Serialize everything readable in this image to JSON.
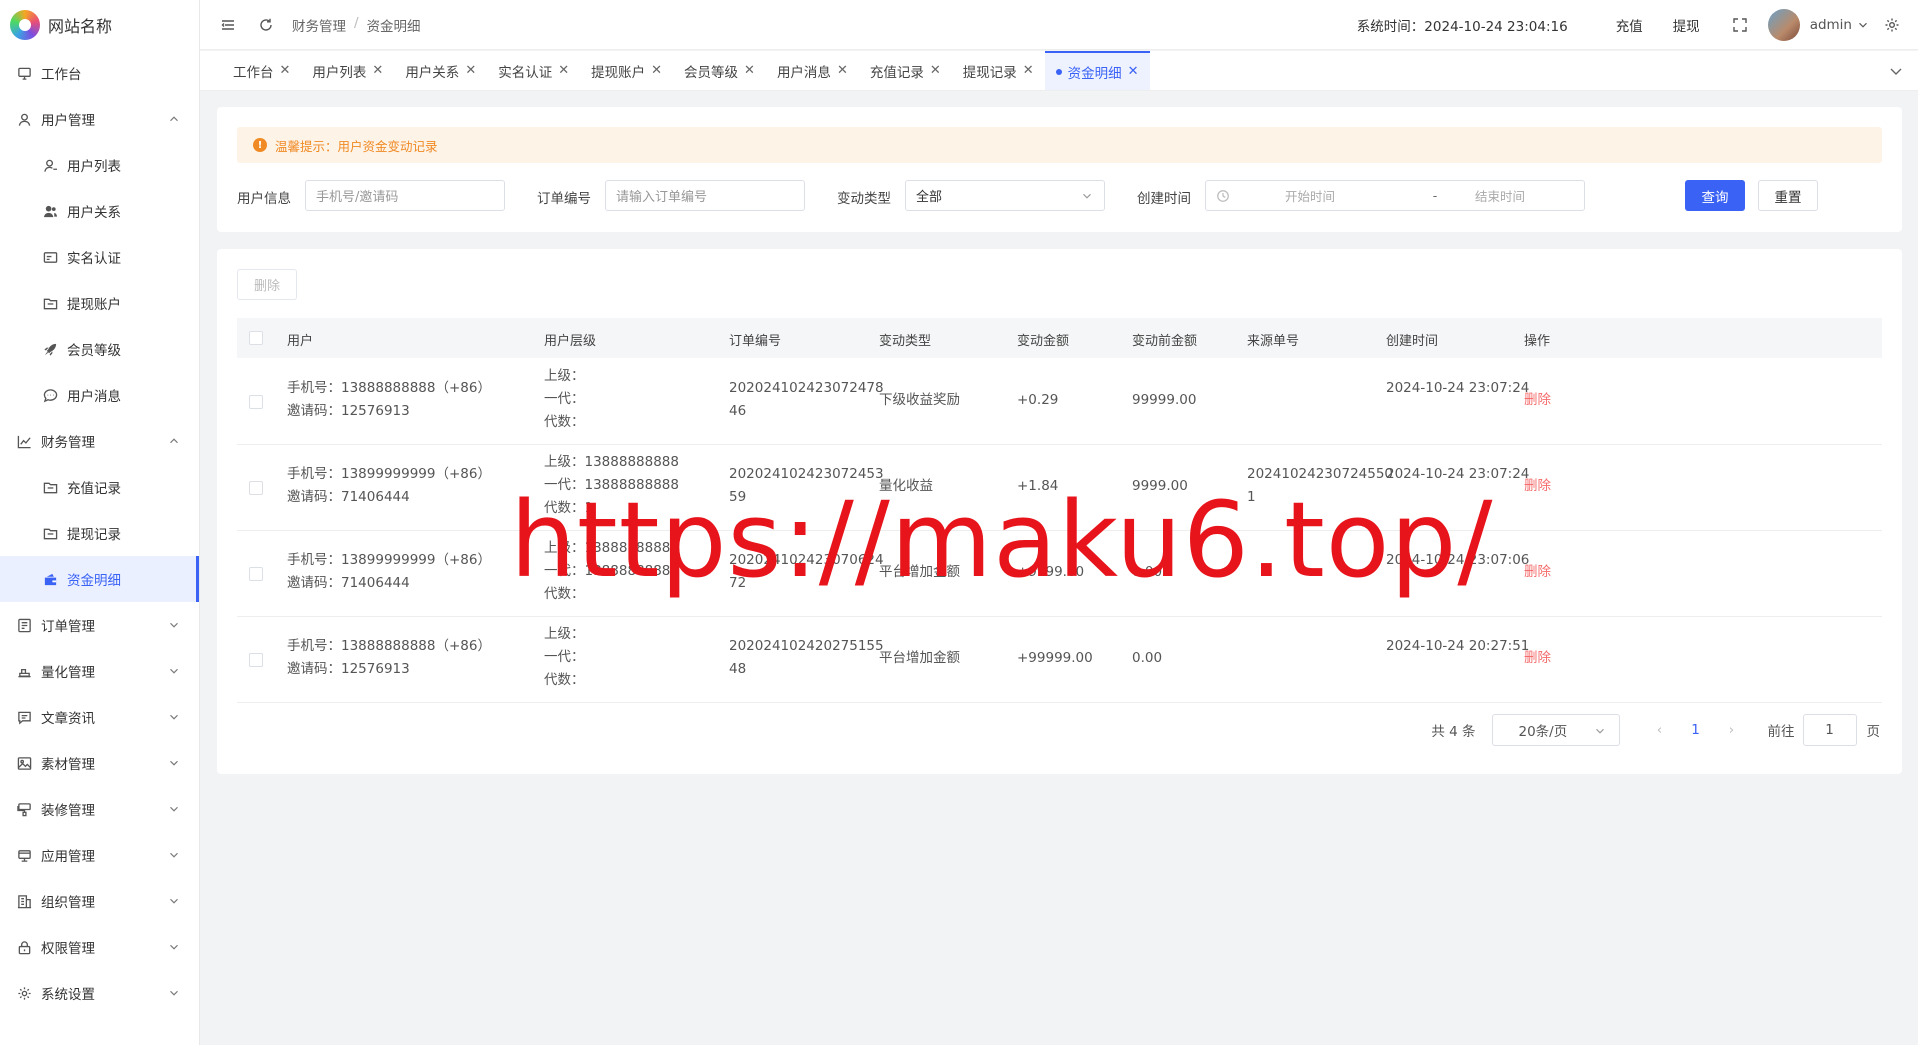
{
  "brand": {
    "name": "网站名称"
  },
  "sidebar": {
    "items": [
      {
        "label": "工作台",
        "icon": "monitor-icon"
      },
      {
        "label": "用户管理",
        "icon": "user-icon",
        "expanded": true
      },
      {
        "label": "用户列表",
        "icon": "user-outline-icon",
        "sub": true
      },
      {
        "label": "用户关系",
        "icon": "users-icon",
        "sub": true
      },
      {
        "label": "实名认证",
        "icon": "id-card-icon",
        "sub": true
      },
      {
        "label": "提现账户",
        "icon": "folder-icon",
        "sub": true
      },
      {
        "label": "会员等级",
        "icon": "rocket-icon",
        "sub": true
      },
      {
        "label": "用户消息",
        "icon": "chat-icon",
        "sub": true
      },
      {
        "label": "财务管理",
        "icon": "chart-icon",
        "expanded": true
      },
      {
        "label": "充值记录",
        "icon": "folder-icon",
        "sub": true
      },
      {
        "label": "提现记录",
        "icon": "folder-icon",
        "sub": true
      },
      {
        "label": "资金明细",
        "icon": "wallet-icon",
        "sub": true,
        "active": true
      },
      {
        "label": "订单管理",
        "icon": "list-icon"
      },
      {
        "label": "量化管理",
        "icon": "bar-icon"
      },
      {
        "label": "文章资讯",
        "icon": "message-icon"
      },
      {
        "label": "素材管理",
        "icon": "image-icon"
      },
      {
        "label": "装修管理",
        "icon": "brush-icon"
      },
      {
        "label": "应用管理",
        "icon": "app-icon"
      },
      {
        "label": "组织管理",
        "icon": "building-icon"
      },
      {
        "label": "权限管理",
        "icon": "lock-icon"
      },
      {
        "label": "系统设置",
        "icon": "gear-icon"
      }
    ]
  },
  "header": {
    "breadcrumb": [
      "财务管理",
      "资金明细"
    ],
    "system_time": "系统时间：2024-10-24 23:04:16",
    "recharge": "充值",
    "withdraw": "提现",
    "user": "admin"
  },
  "tabs": [
    {
      "label": "工作台"
    },
    {
      "label": "用户列表"
    },
    {
      "label": "用户关系"
    },
    {
      "label": "实名认证"
    },
    {
      "label": "提现账户"
    },
    {
      "label": "会员等级"
    },
    {
      "label": "用户消息"
    },
    {
      "label": "充值记录"
    },
    {
      "label": "提现记录"
    },
    {
      "label": "资金明细",
      "active": true
    }
  ],
  "filter": {
    "tip": "温馨提示：用户资金变动记录",
    "user_info_label": "用户信息",
    "user_info_placeholder": "手机号/邀请码",
    "order_label": "订单编号",
    "order_placeholder": "请输入订单编号",
    "type_label": "变动类型",
    "type_value": "全部",
    "created_label": "创建时间",
    "start_placeholder": "开始时间",
    "range_sep": "-",
    "end_placeholder": "结束时间",
    "query": "查询",
    "reset": "重置"
  },
  "table": {
    "delete_btn": "删除",
    "columns": [
      "用户",
      "用户层级",
      "订单编号",
      "变动类型",
      "变动金额",
      "变动前金额",
      "来源单号",
      "创建时间",
      "操作"
    ],
    "rows": [
      {
        "phone": "手机号：13888888888（+86）",
        "invite": "邀请码：12576913",
        "upper": "上级：",
        "gen1": "一代：",
        "gen_count": "代数：",
        "order": "20202410242307247846",
        "type": "下级收益奖励",
        "amount": "+0.29",
        "before": "99999.00",
        "source": "",
        "created": "2024-10-24 23:07:24",
        "op": "删除"
      },
      {
        "phone": "手机号：13899999999（+86）",
        "invite": "邀请码：71406444",
        "upper": "上级：13888888888",
        "gen1": "一代：13888888888",
        "gen_count": "代数：1",
        "order": "20202410242307245359",
        "type": "量化收益",
        "amount": "+1.84",
        "before": "9999.00",
        "source": "202410242307245501",
        "created": "2024-10-24 23:07:24",
        "op": "删除"
      },
      {
        "phone": "手机号：13899999999（+86）",
        "invite": "邀请码：71406444",
        "upper": "上级：13888888888",
        "gen1": "一代：13888888888",
        "gen_count": "代数：",
        "order": "20202410242307062472",
        "type": "平台增加金额",
        "amount": "+9999.00",
        "before": "0.00",
        "source": "",
        "created": "2024-10-24 23:07:06",
        "op": "删除"
      },
      {
        "phone": "手机号：13888888888（+86）",
        "invite": "邀请码：12576913",
        "upper": "上级：",
        "gen1": "一代：",
        "gen_count": "代数：",
        "order": "20202410242027515548",
        "type": "平台增加金额",
        "amount": "+99999.00",
        "before": "0.00",
        "source": "",
        "created": "2024-10-24 20:27:51",
        "op": "删除"
      }
    ]
  },
  "pagination": {
    "total": "共 4 条",
    "page_size": "20条/页",
    "current": "1",
    "goto_label": "前往",
    "goto_value": "1",
    "page_unit": "页"
  },
  "watermark": "https://maku6.top/"
}
